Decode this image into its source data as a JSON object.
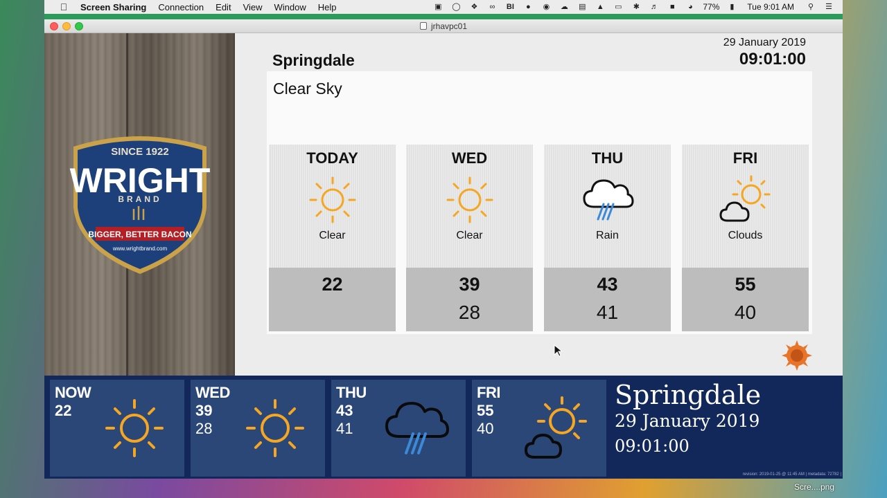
{
  "menubar": {
    "app": "Screen Sharing",
    "items": [
      "Connection",
      "Edit",
      "View",
      "Window",
      "Help"
    ],
    "battery": "77%",
    "clock": "Tue 9:01 AM"
  },
  "window": {
    "title": "jrhavpc01"
  },
  "logo": {
    "since": "SINCE 1922",
    "brand": "WRIGHT",
    "sub": "BRAND",
    "tagline": "BIGGER, BETTER BACON",
    "url": "www.wrightbrand.com"
  },
  "main": {
    "city": "Springdale",
    "date": "29 January 2019",
    "time": "09:01:00",
    "condition": "Clear Sky",
    "days": [
      {
        "name": "TODAY",
        "icon": "sun-icon",
        "cond": "Clear",
        "hi": "22",
        "lo": ""
      },
      {
        "name": "WED",
        "icon": "sun-icon",
        "cond": "Clear",
        "hi": "39",
        "lo": "28"
      },
      {
        "name": "THU",
        "icon": "rain-cloud-icon",
        "cond": "Rain",
        "hi": "43",
        "lo": "41"
      },
      {
        "name": "FRI",
        "icon": "sun-cloud-icon",
        "cond": "Clouds",
        "hi": "55",
        "lo": "40"
      }
    ]
  },
  "ticker": {
    "tiles": [
      {
        "label": "NOW",
        "hi": "22",
        "lo": "",
        "icon": "sun-icon"
      },
      {
        "label": "WED",
        "hi": "39",
        "lo": "28",
        "icon": "sun-icon"
      },
      {
        "label": "THU",
        "hi": "43",
        "lo": "41",
        "icon": "rain-cloud-icon"
      },
      {
        "label": "FRI",
        "hi": "55",
        "lo": "40",
        "icon": "sun-cloud-icon"
      }
    ],
    "city": "Springdale",
    "date": "29 January 2019",
    "time": "09:01:00",
    "revision": "revision: 2019-01-25 @ 11:45 AM | metadata: 72782 |"
  },
  "desktop": {
    "file": "Scre....png"
  },
  "colors": {
    "sun": "#f5a623",
    "rain": "#3a8ad8",
    "ticker_bg": "#13285a",
    "tile_bg": "#2a4777"
  }
}
